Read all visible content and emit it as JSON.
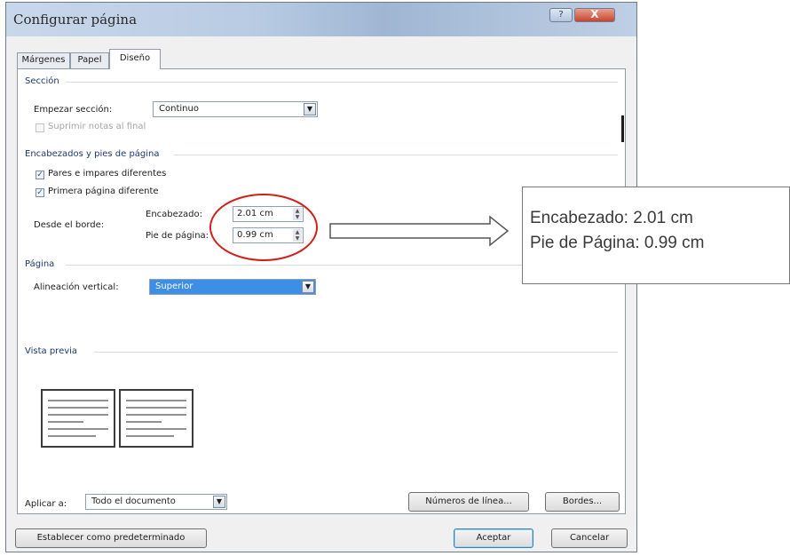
{
  "window": {
    "title": "Configurar página",
    "help_label": "?",
    "close_label": "X"
  },
  "tabs": [
    {
      "label": "Márgenes",
      "active": false
    },
    {
      "label": "Papel",
      "active": false
    },
    {
      "label": "Diseño",
      "active": true
    }
  ],
  "section": {
    "heading": "Sección",
    "start_label": "Empezar sección:",
    "start_value": "Continuo",
    "suppress_endnotes_label": "Suprimir notas al final",
    "suppress_endnotes_checked": false
  },
  "headers_footers": {
    "heading": "Encabezados y pies de página",
    "odd_even_label": "Pares e impares diferentes",
    "odd_even_checked": true,
    "first_page_label": "Primera página diferente",
    "first_page_checked": true,
    "from_edge_label": "Desde el borde:",
    "header_label": "Encabezado:",
    "header_value": "2.01 cm",
    "footer_label": "Pie de página:",
    "footer_value": "0.99 cm"
  },
  "page": {
    "heading": "Página",
    "vertical_align_label": "Alineación vertical:",
    "vertical_align_value": "Superior"
  },
  "preview": {
    "heading": "Vista previa"
  },
  "apply": {
    "label": "Aplicar a:",
    "value": "Todo el documento"
  },
  "buttons": {
    "line_numbers": "Números de línea...",
    "borders": "Bordes...",
    "set_default": "Establecer como predeterminado",
    "ok": "Aceptar",
    "cancel": "Cancelar"
  },
  "callout": {
    "line1": "Encabezado: 2.01 cm",
    "line2": "Pie de Página: 0.99 cm"
  },
  "colors": {
    "highlight_circle": "#d0201a",
    "selection": "#3d8ee6"
  }
}
